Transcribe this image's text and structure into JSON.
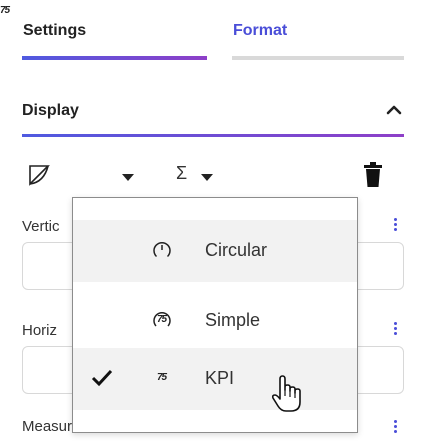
{
  "tabs": [
    {
      "label": "Settings",
      "active": true
    },
    {
      "label": "Format",
      "active": false
    }
  ],
  "section": {
    "title": "Display",
    "expanded": true
  },
  "toolbar": {
    "kpi_glyph": "75",
    "sigma_glyph": "Σ"
  },
  "fields": {
    "vertical_label": "Vertic",
    "horizontal_label": "Horiz",
    "measure_label": "Measure"
  },
  "dropdown": {
    "items": [
      {
        "label": "Circular",
        "icon": "circular-gauge-icon",
        "selected": false
      },
      {
        "label": "Simple",
        "icon": "simple-gauge-icon",
        "icon_text": "75",
        "selected": false
      },
      {
        "label": "KPI",
        "icon": "kpi-icon",
        "icon_text": "75",
        "selected": true
      }
    ]
  },
  "colors": {
    "accent": "#4a4ed8",
    "accent_gradient_end": "#8e3fc8",
    "hover_bg": "#f2f2f2"
  }
}
